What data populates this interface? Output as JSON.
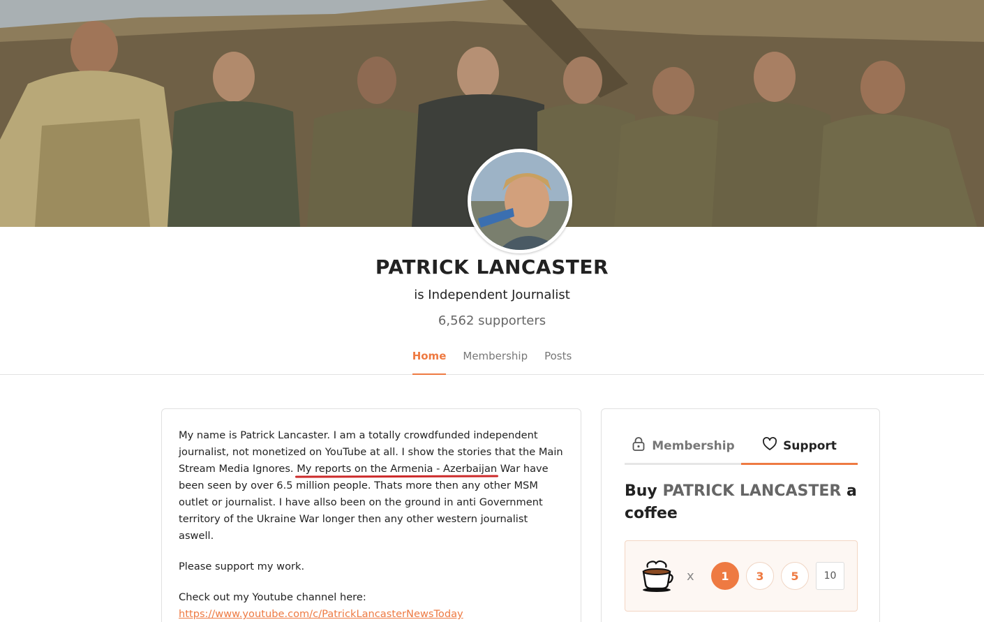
{
  "creator": {
    "name": "PATRICK LANCASTER",
    "tagline": "is Independent Journalist",
    "supporters": "6,562 supporters"
  },
  "nav": {
    "home": "Home",
    "membership": "Membership",
    "posts": "Posts"
  },
  "about": {
    "p1_before": "My name is Patrick Lancaster. I am a totally crowdfunded independent journalist, not monetized on YouTube at all. I show the stories that the Main Stream Media Ignores. ",
    "p1_highlight": "My reports on the Armenia - Azerbaijan",
    "p1_after": " War have been seen by over 6.5 million people. Thats more then any other MSM outlet or journalist. I have allso been on the ground in anti Government territory of the Ukraine War longer then any other western journalist aswell.",
    "p2": "Please support my work.",
    "p3": "Check out my Youtube channel here:",
    "link": "https://www.youtube.com/c/PatrickLancasterNewsToday"
  },
  "support": {
    "tab_membership": "Membership",
    "tab_support": "Support",
    "buy_prefix": "Buy ",
    "buy_name": "PATRICK LANCASTER",
    "buy_suffix": " a coffee",
    "times": "x",
    "qty_1": "1",
    "qty_3": "3",
    "qty_5": "5",
    "qty_custom": "10"
  },
  "colors": {
    "accent": "#ee7a42",
    "highlight_underline": "#cc2a2a"
  },
  "icons": {
    "membership_tab": "lock-icon",
    "support_tab": "heart-icon",
    "coffee": "coffee-cup-icon"
  }
}
